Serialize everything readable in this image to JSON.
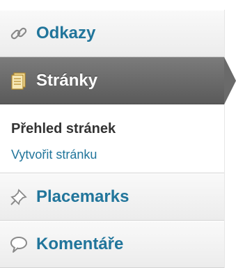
{
  "menu": {
    "odkazy": {
      "label": "Odkazy",
      "icon": "link-icon"
    },
    "stranky": {
      "label": "Stránky",
      "icon": "pages-icon"
    },
    "submenu": {
      "current": "Přehled stránek",
      "create": "Vytvořit stránku"
    },
    "placemarks": {
      "label": "Placemarks",
      "icon": "pin-icon"
    },
    "komentare": {
      "label": "Komentáře",
      "icon": "comment-icon"
    }
  },
  "colors": {
    "link": "#21759b",
    "active_bg": "#6a6a6a",
    "text_dark": "#333333"
  }
}
